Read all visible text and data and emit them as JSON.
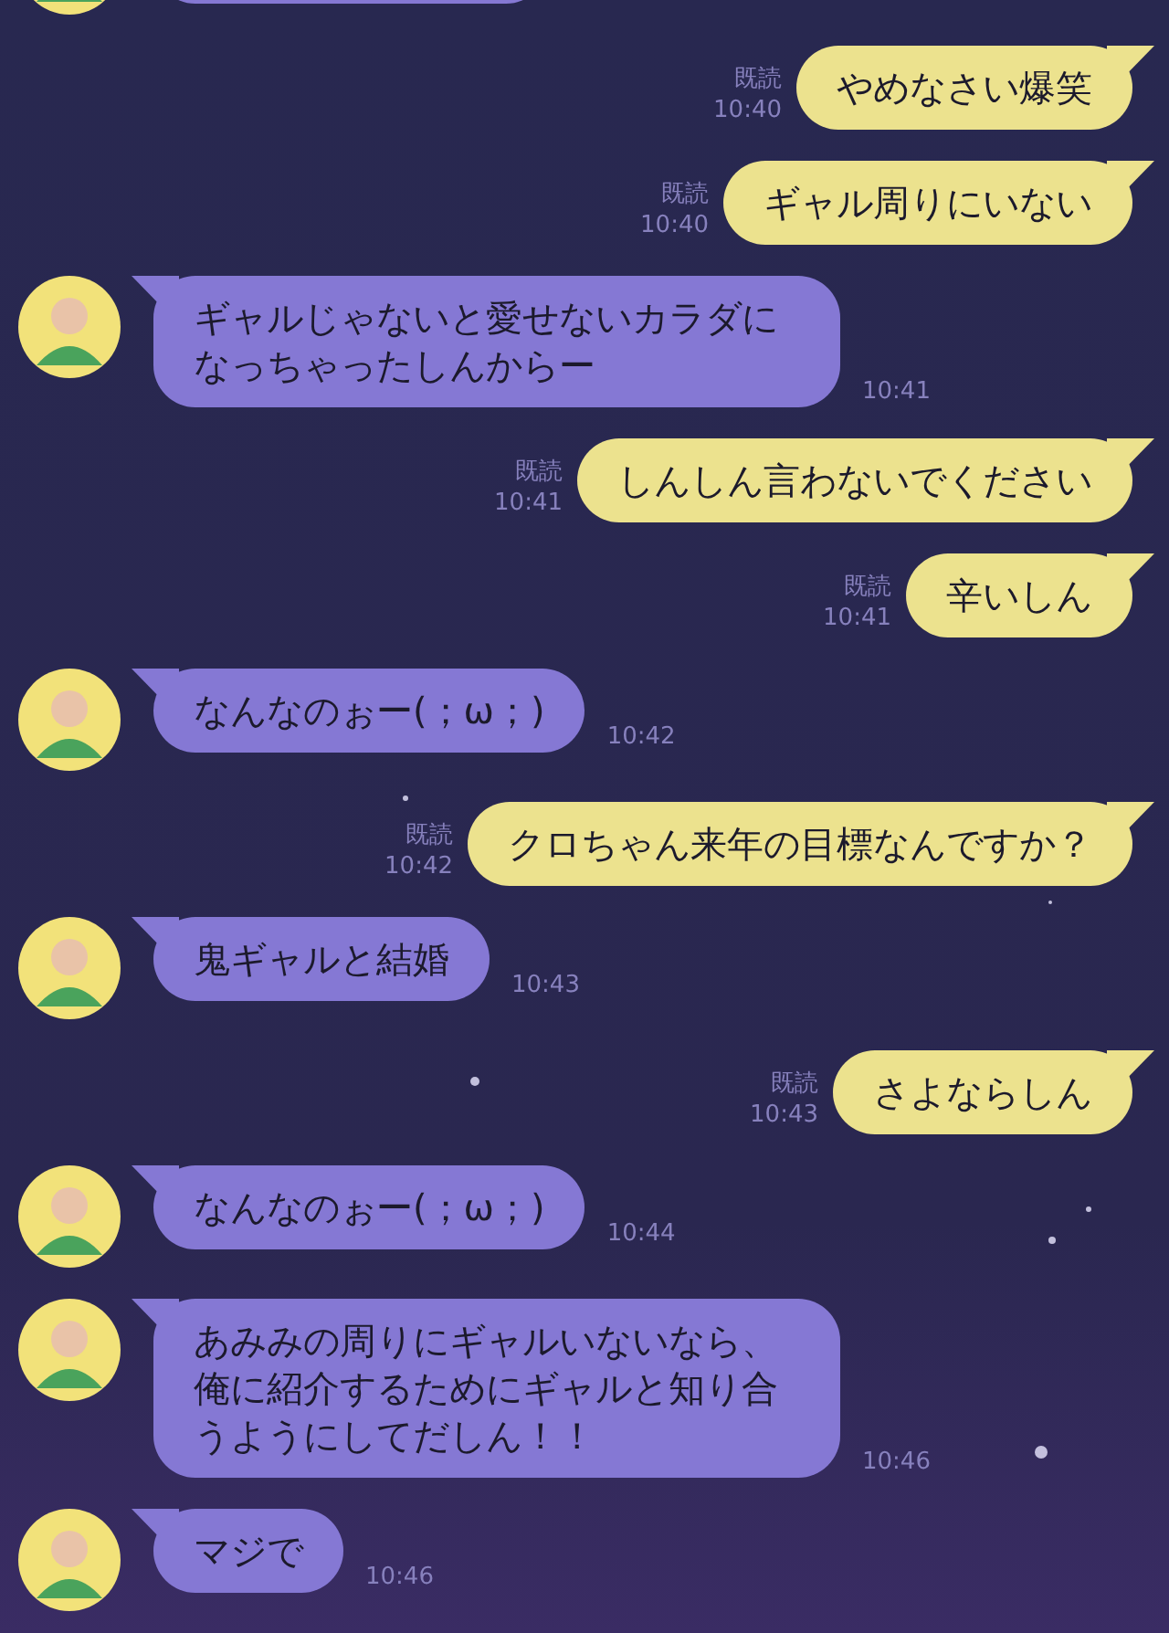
{
  "messages": [
    {
      "kind": "received_cut"
    },
    {
      "kind": "sent",
      "text": "やめなさい爆笑",
      "read_label": "既読",
      "time": "10:40"
    },
    {
      "kind": "sent",
      "text": "ギャル周りにいない",
      "read_label": "既読",
      "time": "10:40"
    },
    {
      "kind": "received",
      "text": "ギャルじゃないと愛せないカラダになっちゃったしんからー",
      "time": "10:41"
    },
    {
      "kind": "sent",
      "text": "しんしん言わないでください",
      "read_label": "既読",
      "time": "10:41"
    },
    {
      "kind": "sent",
      "text": "辛いしん",
      "read_label": "既読",
      "time": "10:41"
    },
    {
      "kind": "received",
      "text": "なんなのぉー(；ω；)",
      "time": "10:42"
    },
    {
      "kind": "sent",
      "text": "クロちゃん来年の目標なんですか？",
      "read_label": "既読",
      "time": "10:42"
    },
    {
      "kind": "received",
      "text": "鬼ギャルと結婚",
      "time": "10:43"
    },
    {
      "kind": "sent",
      "text": "さよならしん",
      "read_label": "既読",
      "time": "10:43"
    },
    {
      "kind": "received",
      "text": "なんなのぉー(；ω；)",
      "time": "10:44"
    },
    {
      "kind": "received",
      "text": "あみみの周りにギャルいないなら、俺に紹介するためにギャルと知り合うようにしてだしん！！",
      "time": "10:46"
    },
    {
      "kind": "received",
      "text": "マジで",
      "time": "10:46"
    }
  ]
}
